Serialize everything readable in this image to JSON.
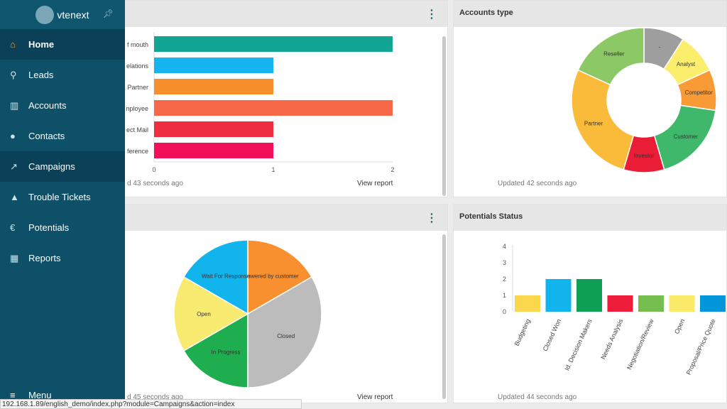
{
  "sidebar": {
    "brand": "vtenext",
    "items": [
      {
        "label": "Home",
        "icon": "home-icon",
        "glyph": "⌂"
      },
      {
        "label": "Leads",
        "icon": "person-outline-icon",
        "glyph": "⚲"
      },
      {
        "label": "Accounts",
        "icon": "building-icon",
        "glyph": "▥"
      },
      {
        "label": "Contacts",
        "icon": "person-icon",
        "glyph": "●"
      },
      {
        "label": "Campaigns",
        "icon": "trend-chart-icon",
        "glyph": "↗"
      },
      {
        "label": "Trouble Tickets",
        "icon": "warning-icon",
        "glyph": "▲"
      },
      {
        "label": "Potentials",
        "icon": "euro-icon",
        "glyph": "€"
      },
      {
        "label": "Reports",
        "icon": "table-icon",
        "glyph": "▦"
      }
    ],
    "menu_label": "Menu"
  },
  "status_url": "192.168.1.89/english_demo/index.php?module=Campaigns&action=index",
  "panels": {
    "top_left": {
      "updated": "d 43 seconds ago",
      "view_report": "View report"
    },
    "top_right": {
      "title": "Accounts type",
      "updated": "Updated 42 seconds ago"
    },
    "bottom_left": {
      "updated": "d 45 seconds ago",
      "view_report": "View report"
    },
    "bottom_right": {
      "title": "Potentials Status",
      "updated": "Updated 44 seconds ago"
    }
  },
  "chart_data": [
    {
      "type": "bar",
      "orientation": "horizontal",
      "categories": [
        "f mouth",
        "elations",
        "Partner",
        "nployee",
        "ect Mail",
        "ference"
      ],
      "values": [
        2,
        1,
        1,
        2,
        1,
        1
      ],
      "colors": [
        "#12a594",
        "#16b4ef",
        "#f7902c",
        "#f76848",
        "#ee2d41",
        "#f2105a"
      ],
      "xticks": [
        "0",
        "1",
        "2"
      ],
      "xlim": [
        0,
        2
      ]
    },
    {
      "type": "pie",
      "donut": true,
      "categories": [
        "-",
        "Analyst",
        "Competitor",
        "Customer",
        "Investor",
        "Partner",
        "Reseller"
      ],
      "values": [
        1,
        1,
        1,
        2,
        1,
        3,
        2
      ],
      "colors": [
        "#9e9e9e",
        "#fbee6c",
        "#f89b36",
        "#3fb86b",
        "#ea1d36",
        "#fbbb3a",
        "#8cc865"
      ]
    },
    {
      "type": "pie",
      "categories": [
        "Answered by customer",
        "Closed",
        "In Progress",
        "Open",
        "Wait For Response"
      ],
      "values": [
        1,
        2,
        1,
        1,
        1
      ],
      "colors": [
        "#f8902f",
        "#bdbcbc",
        "#1fae4f",
        "#f9eb72",
        "#12b4ee"
      ]
    },
    {
      "type": "bar",
      "categories": [
        "Budgeting",
        "Closed Won",
        "Id. Decision Makers",
        "Needs Analysis",
        "Negotiation/Review",
        "Open",
        "Proposal/Price Quote"
      ],
      "values": [
        1,
        2,
        2,
        1,
        1,
        1,
        1
      ],
      "colors": [
        "#fad74c",
        "#12b4ee",
        "#0f9f55",
        "#ee1d3a",
        "#76bd4f",
        "#fbe96a",
        "#0096d9"
      ],
      "yticks": [
        "0",
        "1",
        "2",
        "3",
        "4"
      ],
      "ylim": [
        0,
        4
      ]
    }
  ]
}
